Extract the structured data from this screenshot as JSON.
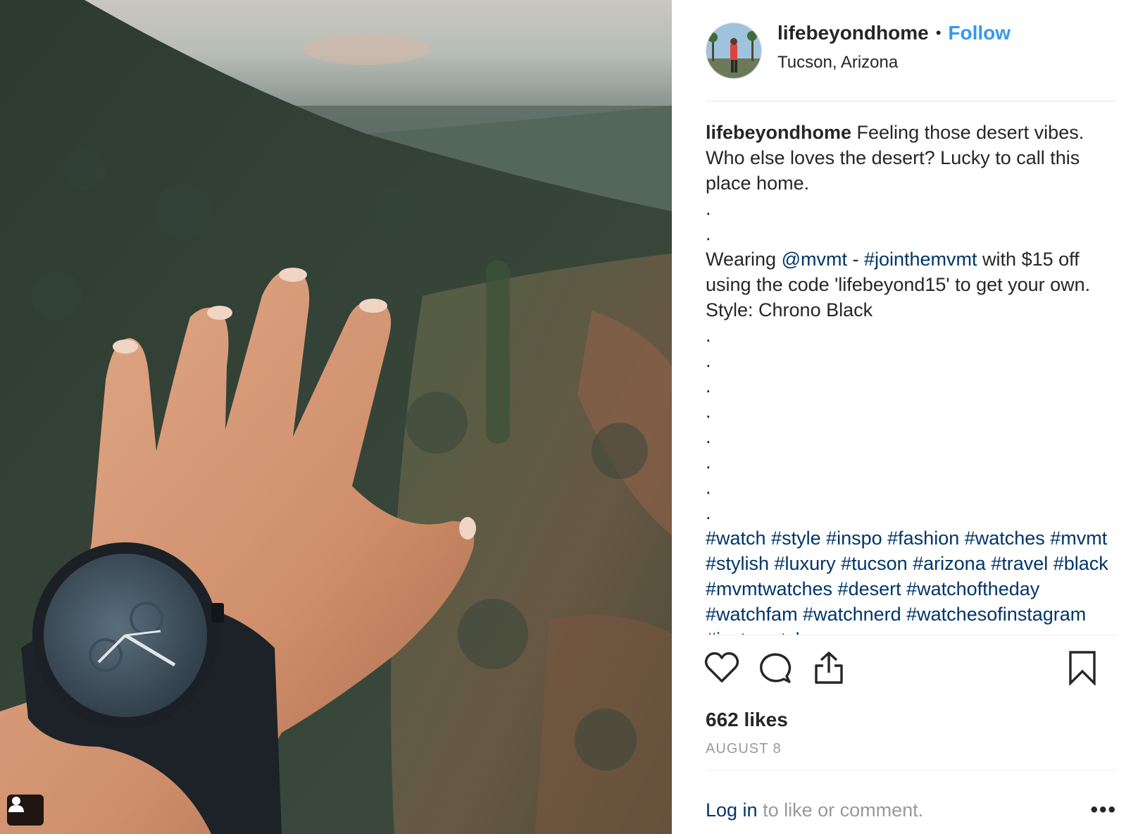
{
  "post": {
    "username": "lifebeyondhome",
    "separator": "•",
    "follow_label": "Follow",
    "location": "Tucson, Arizona",
    "caption": {
      "username": "lifebeyondhome",
      "line1": " Feeling those desert vibes. Who else loves the desert? Lucky to call this place home.",
      "wearing_prefix": "Wearing ",
      "mention": "@mvmt",
      "dash": " - ",
      "hashtag_main": "#jointhemvmt",
      "wearing_suffix": " with $15 off using the code 'lifebeyond15' to get your own. Style: Chrono Black",
      "dot": ".",
      "hashtags": "#watch #style #inspo #fashion #watches #mvmt #stylish #luxury #tucson #arizona #travel #black #mvmtwatches #desert #watchoftheday #watchfam #watchnerd #watchesofinstagram #instawatch"
    },
    "likes": "662 likes",
    "date": "AUGUST 8",
    "footer": {
      "login_label": "Log in",
      "rest": " to like or comment.",
      "more": "•••"
    }
  },
  "icons": {
    "like": "heart-icon",
    "comment": "comment-icon",
    "share": "share-icon",
    "save": "bookmark-icon",
    "tag": "user-tag-icon"
  },
  "colors": {
    "follow": "#3897f0",
    "link": "#003569",
    "muted": "#999999",
    "text": "#262626"
  }
}
